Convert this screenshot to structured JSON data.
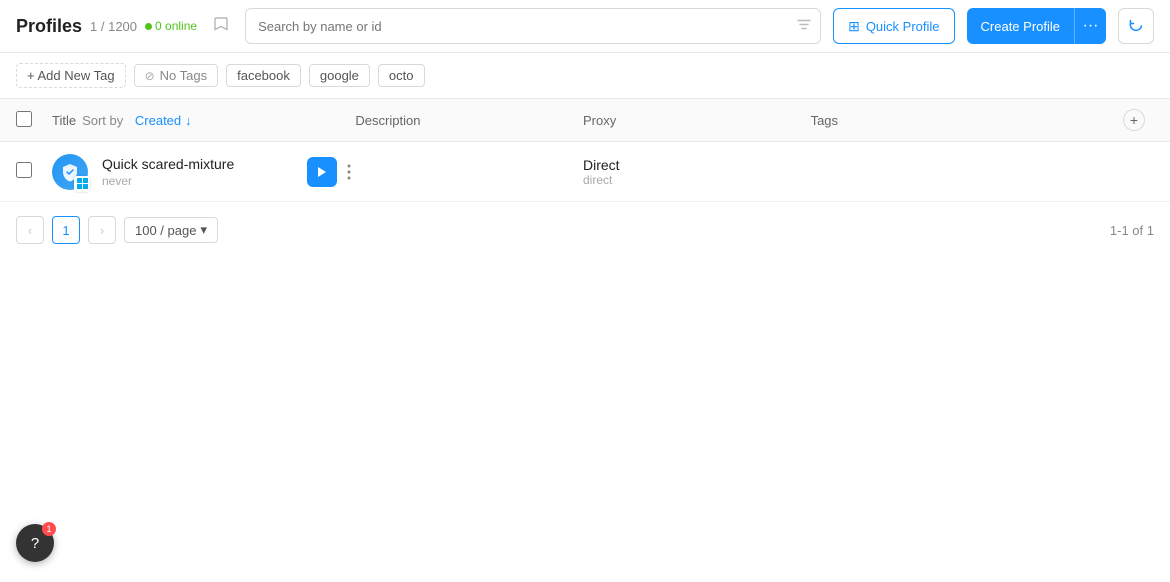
{
  "header": {
    "title": "Profiles",
    "count": "1 / 1200",
    "online_label": "0 online",
    "search_placeholder": "Search by name or id",
    "quick_profile_label": "Quick Profile",
    "create_profile_label": "Create Profile"
  },
  "tags": {
    "add_label": "+ Add New Tag",
    "items": [
      {
        "id": "no-tags",
        "label": "No Tags",
        "has_icon": true
      },
      {
        "id": "facebook",
        "label": "facebook",
        "has_icon": false
      },
      {
        "id": "google",
        "label": "google",
        "has_icon": false
      },
      {
        "id": "octo",
        "label": "octo",
        "has_icon": false
      }
    ]
  },
  "table": {
    "columns": {
      "title": "Title",
      "sort_by_label": "Sort by",
      "sort_field": "Created",
      "description": "Description",
      "proxy": "Proxy",
      "tags": "Tags"
    },
    "rows": [
      {
        "id": "1",
        "name": "Quick scared-mixture",
        "sub": "never",
        "os": "win",
        "description": "",
        "proxy_name": "Direct",
        "proxy_type": "direct",
        "tags": ""
      }
    ]
  },
  "pagination": {
    "prev_label": "‹",
    "next_label": "›",
    "current_page": "1",
    "per_page": "100 / page",
    "range_label": "1-1 of 1"
  },
  "help": {
    "label": "?"
  }
}
